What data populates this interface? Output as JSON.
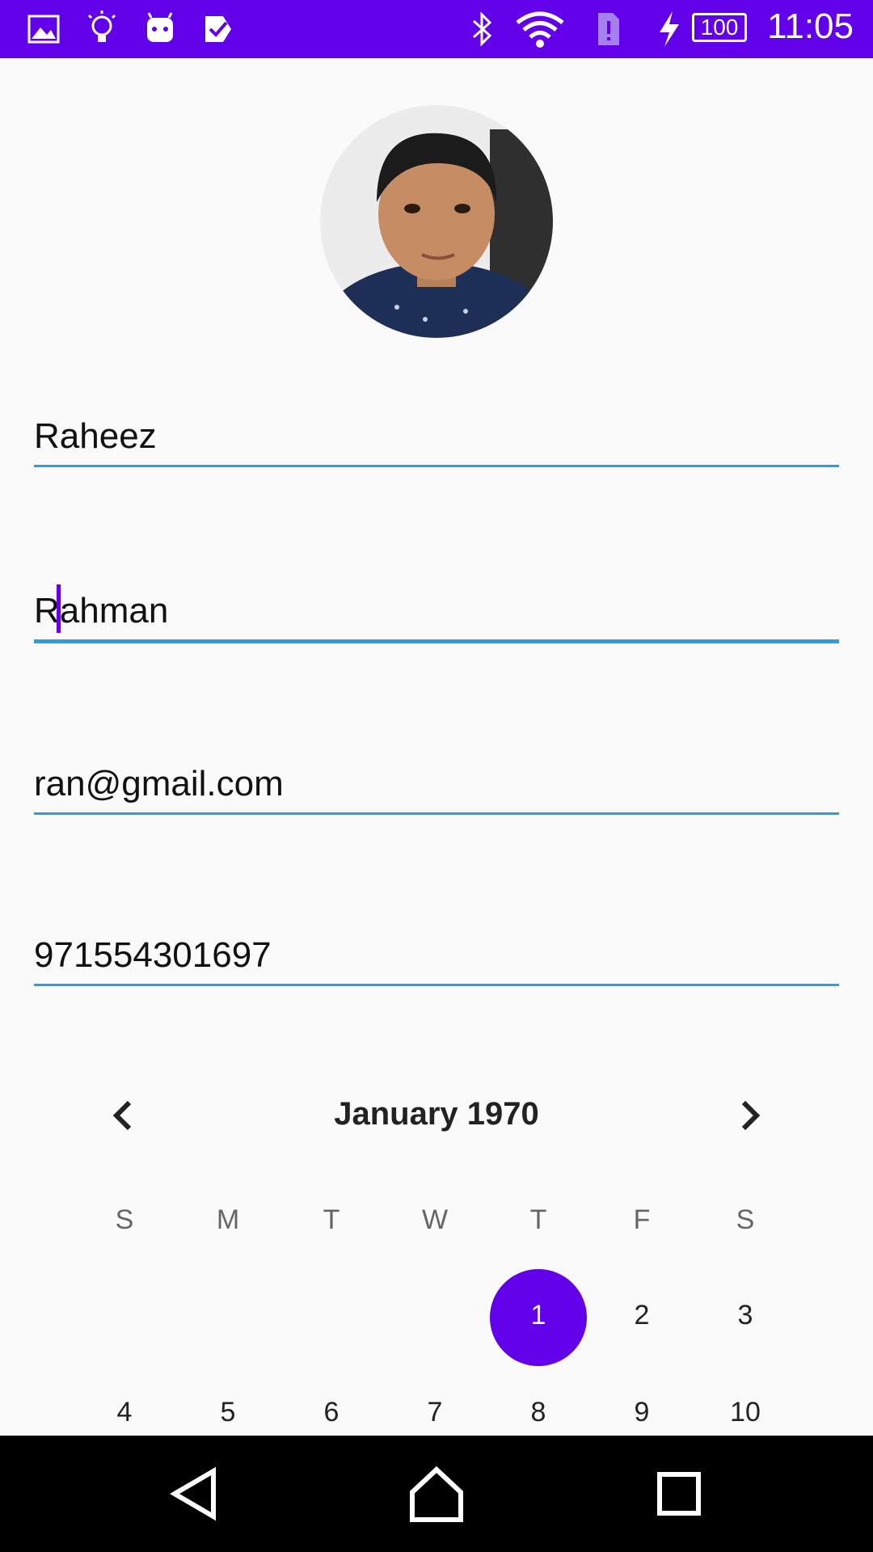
{
  "status_bar": {
    "time": "11:05",
    "battery": "100",
    "icons": [
      "image-icon",
      "lightbulb-icon",
      "android-icon",
      "task-check-icon",
      "bluetooth-icon",
      "wifi-icon",
      "sim-alert-icon",
      "charging-icon",
      "battery-icon"
    ]
  },
  "profile": {
    "avatar": "avatar-photo"
  },
  "form": {
    "first_name": "Raheez",
    "last_name": "Rahman",
    "email": "ran@gmail.com",
    "phone": "971554301697"
  },
  "calendar": {
    "title": "January 1970",
    "weekdays": [
      "S",
      "M",
      "T",
      "W",
      "T",
      "F",
      "S"
    ],
    "week1": [
      "",
      "",
      "",
      "",
      "1",
      "2",
      "3"
    ],
    "week2": [
      "4",
      "5",
      "6",
      "7",
      "8",
      "9",
      "10"
    ],
    "selected_day": "1",
    "accent_color": "#6200ea"
  },
  "nav_bar": {
    "icons": [
      "back-icon",
      "home-icon",
      "recents-icon"
    ]
  }
}
